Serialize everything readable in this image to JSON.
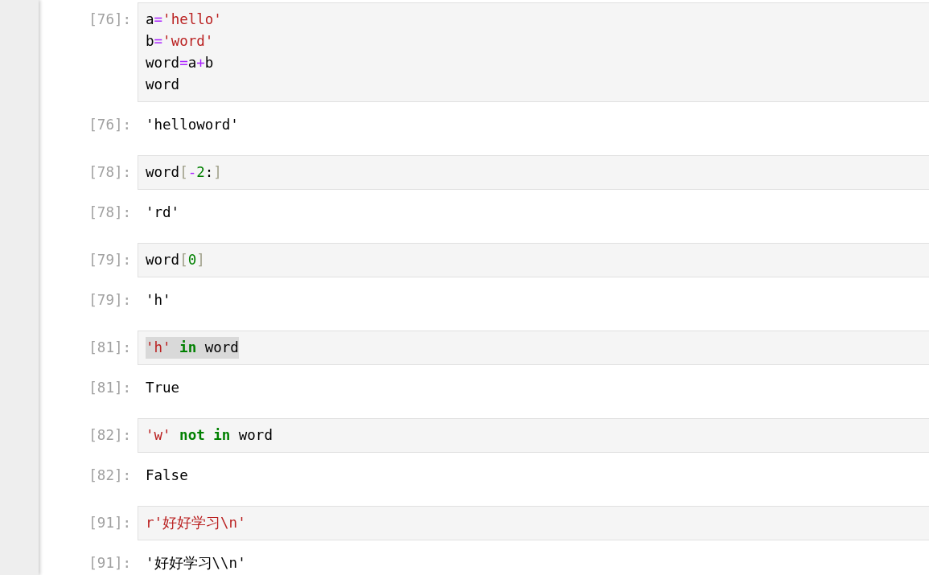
{
  "cells": [
    {
      "input_prompt": "[76]:",
      "lines": [
        {
          "selected": false,
          "tokens": [
            {
              "kind": "name",
              "text": "a"
            },
            {
              "kind": "op",
              "text": "="
            },
            {
              "kind": "str",
              "text": "'hello'"
            }
          ]
        },
        {
          "selected": false,
          "tokens": [
            {
              "kind": "name",
              "text": "b"
            },
            {
              "kind": "op",
              "text": "="
            },
            {
              "kind": "str",
              "text": "'word'"
            }
          ]
        },
        {
          "selected": false,
          "tokens": [
            {
              "kind": "name",
              "text": "word"
            },
            {
              "kind": "op",
              "text": "="
            },
            {
              "kind": "name",
              "text": "a"
            },
            {
              "kind": "op",
              "text": "+"
            },
            {
              "kind": "name",
              "text": "b"
            }
          ]
        },
        {
          "selected": false,
          "tokens": [
            {
              "kind": "name",
              "text": "word"
            }
          ]
        }
      ],
      "output_prompt": "[76]:",
      "output": "'helloword'"
    },
    {
      "input_prompt": "[78]:",
      "lines": [
        {
          "selected": false,
          "tokens": [
            {
              "kind": "name",
              "text": "word"
            },
            {
              "kind": "punc",
              "text": "["
            },
            {
              "kind": "op",
              "text": "-"
            },
            {
              "kind": "num",
              "text": "2"
            },
            {
              "kind": "name",
              "text": ":"
            },
            {
              "kind": "punc",
              "text": "]"
            }
          ]
        }
      ],
      "output_prompt": "[78]:",
      "output": "'rd'"
    },
    {
      "input_prompt": "[79]:",
      "lines": [
        {
          "selected": false,
          "tokens": [
            {
              "kind": "name",
              "text": "word"
            },
            {
              "kind": "punc",
              "text": "["
            },
            {
              "kind": "num",
              "text": "0"
            },
            {
              "kind": "punc",
              "text": "]"
            }
          ]
        }
      ],
      "output_prompt": "[79]:",
      "output": "'h'"
    },
    {
      "input_prompt": "[81]:",
      "lines": [
        {
          "selected": true,
          "tokens": [
            {
              "kind": "str",
              "text": "'h'",
              "space_after": true
            },
            {
              "kind": "kw",
              "text": "in",
              "space_after": true
            },
            {
              "kind": "name",
              "text": "word",
              "space_after": false
            }
          ]
        }
      ],
      "output_prompt": "[81]:",
      "output": "True"
    },
    {
      "input_prompt": "[82]:",
      "lines": [
        {
          "selected": false,
          "tokens": [
            {
              "kind": "str",
              "text": "'w'",
              "space_after": true
            },
            {
              "kind": "kw",
              "text": "not",
              "space_after": true
            },
            {
              "kind": "kw",
              "text": "in",
              "space_after": true
            },
            {
              "kind": "name",
              "text": "word",
              "space_after": false
            }
          ]
        }
      ],
      "output_prompt": "[82]:",
      "output": "False"
    },
    {
      "input_prompt": "[91]:",
      "lines": [
        {
          "selected": false,
          "tokens": [
            {
              "kind": "str",
              "text": "r'好好学习\\n'"
            }
          ]
        }
      ],
      "output_prompt": "[91]:",
      "output": "'好好学习\\\\n'"
    }
  ]
}
